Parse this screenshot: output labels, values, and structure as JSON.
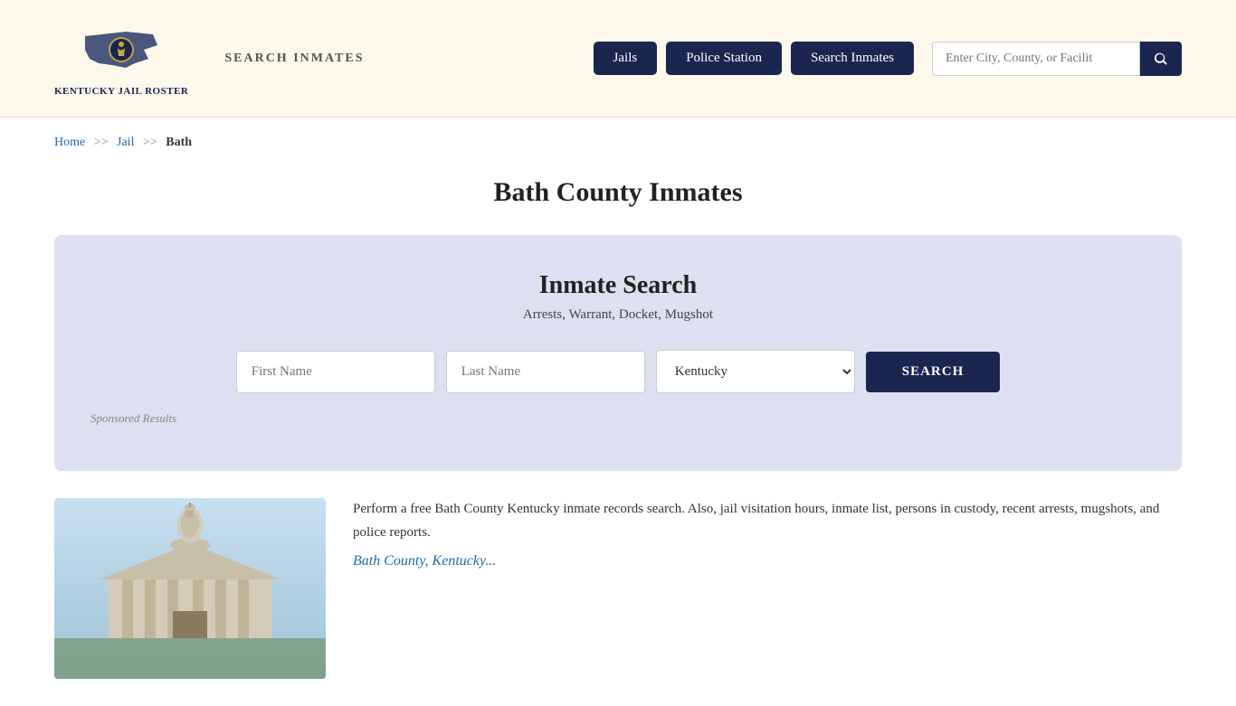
{
  "header": {
    "logo_text": "KENTUCKY\nJAIL ROSTER",
    "site_title": "SEARCH INMATES",
    "nav": {
      "jails_label": "Jails",
      "police_station_label": "Police Station",
      "search_inmates_label": "Search Inmates"
    },
    "search": {
      "placeholder": "Enter City, County, or Facilit"
    }
  },
  "breadcrumb": {
    "home": "Home",
    "sep1": ">>",
    "jail": "Jail",
    "sep2": ">>",
    "current": "Bath"
  },
  "page": {
    "title": "Bath County Inmates"
  },
  "inmate_search": {
    "title": "Inmate Search",
    "subtitle": "Arrests, Warrant, Docket, Mugshot",
    "first_name_placeholder": "First Name",
    "last_name_placeholder": "Last Name",
    "state_default": "Kentucky",
    "search_button": "SEARCH",
    "sponsored_label": "Sponsored Results"
  },
  "content": {
    "description": "Perform a free Bath County Kentucky inmate records search. Also, jail visitation hours, inmate list, persons in custody, recent arrests, mugshots, and police reports.",
    "link_title": "Bath County, Kentucky..."
  },
  "colors": {
    "navy": "#1a2550",
    "header_bg": "#fdf8ec",
    "search_box_bg": "#dde0f0",
    "link_blue": "#1a6bb5"
  }
}
